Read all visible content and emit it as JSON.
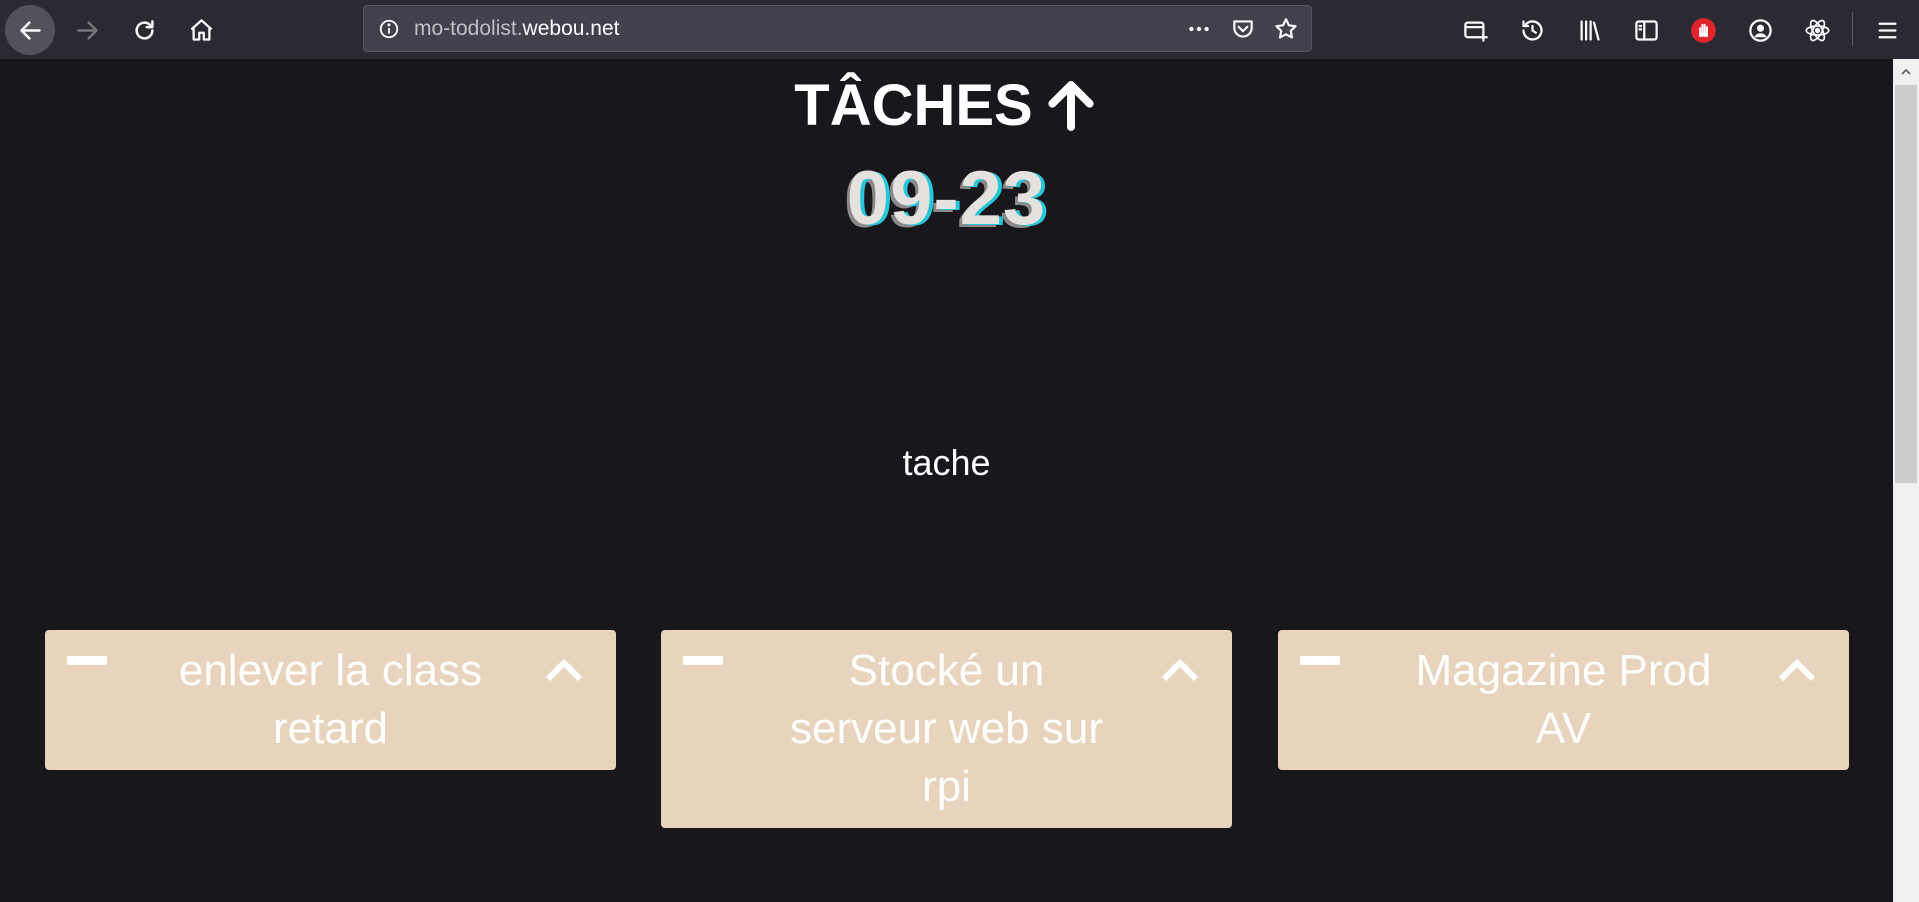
{
  "browser": {
    "url_prefix": "mo-todolist.",
    "url_domain": "webou.net",
    "icons": {
      "back": "arrow-left-icon",
      "forward": "arrow-right-icon",
      "reload": "reload-icon",
      "home": "home-icon",
      "info": "info-icon",
      "page_actions": "more-horizontal-icon",
      "pocket": "pocket-icon",
      "bookmark": "star-icon",
      "new_container": "container-tab-icon",
      "history": "history-icon",
      "library": "library-icon",
      "sidebar": "sidebar-icon",
      "adblock": "stop-hand-icon",
      "account": "account-icon",
      "react_devtools": "react-icon",
      "menu": "hamburger-menu-icon"
    }
  },
  "page": {
    "title": "TÂCHES",
    "title_icon": "arrow-up-icon",
    "date": "09-23",
    "section_label": "tache",
    "colors": {
      "background": "#18171c",
      "card": "#e8d3bc",
      "date_shadow": "#27c6d9"
    },
    "tasks": [
      {
        "text": "enlever la class retard"
      },
      {
        "text": "Stocké un serveur web sur rpi"
      },
      {
        "text": "Magazine Prod AV"
      }
    ]
  }
}
